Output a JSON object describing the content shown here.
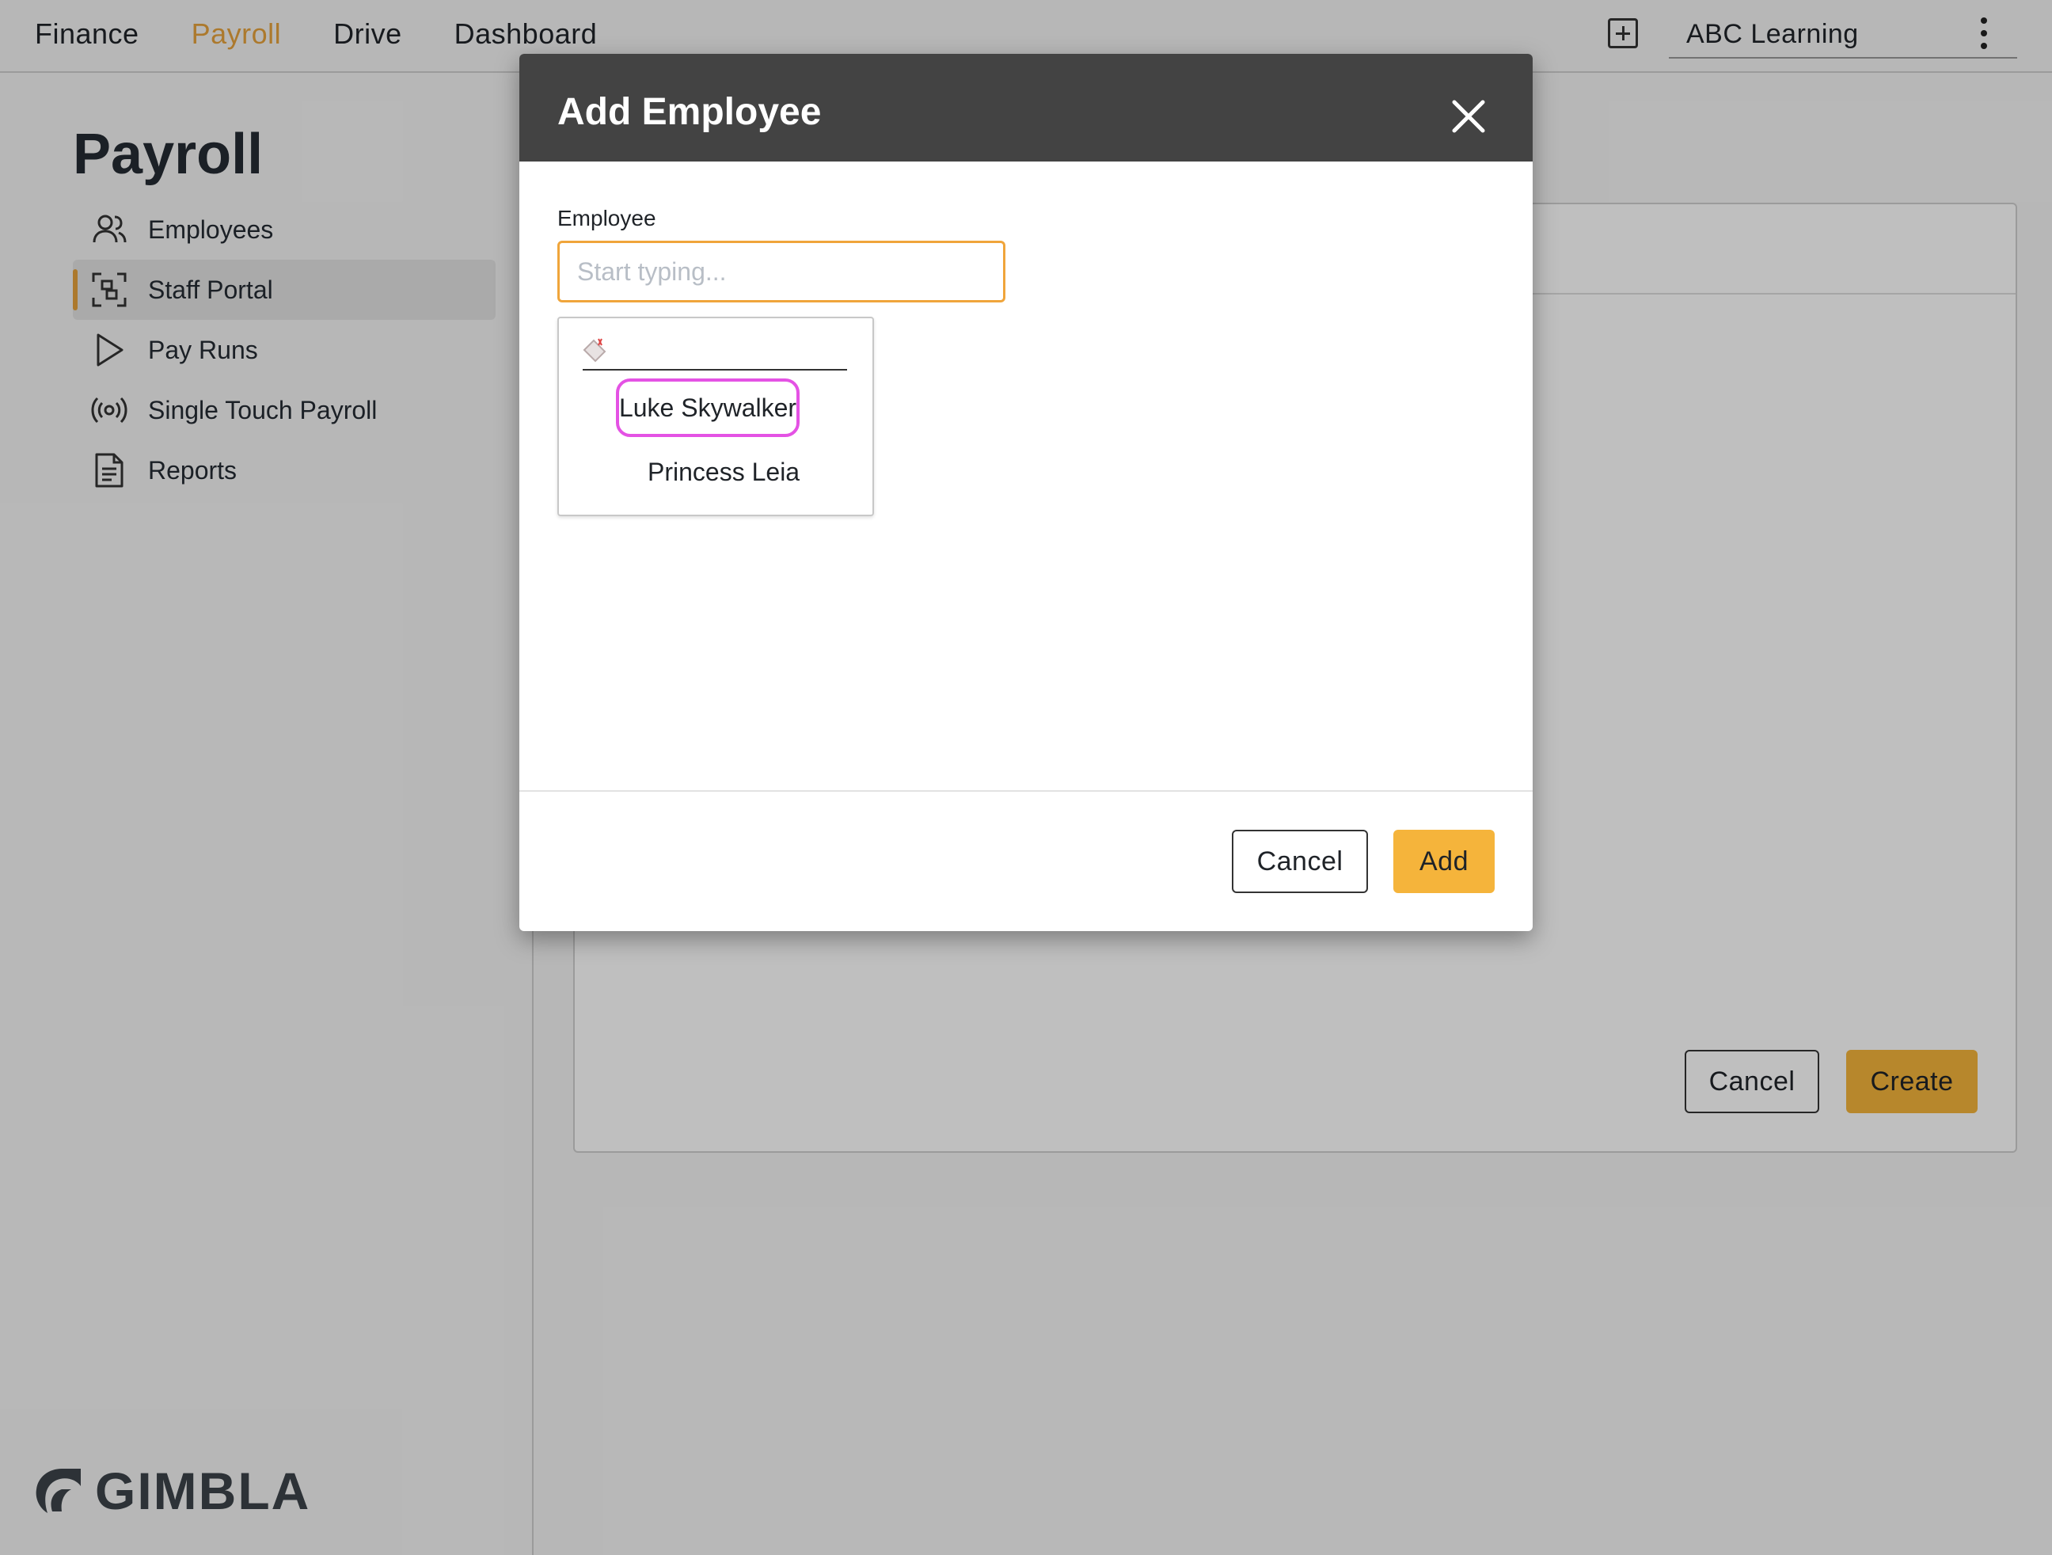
{
  "topnav": {
    "items": [
      {
        "label": "Finance",
        "active": false
      },
      {
        "label": "Payroll",
        "active": true
      },
      {
        "label": "Drive",
        "active": false
      },
      {
        "label": "Dashboard",
        "active": false
      }
    ],
    "add_icon": "plus-square-icon",
    "organization": "ABC Learning",
    "menu_icon": "kebab-menu-icon"
  },
  "sidebar": {
    "title": "Payroll",
    "items": [
      {
        "label": "Employees",
        "icon": "people-icon",
        "active": false
      },
      {
        "label": "Staff Portal",
        "icon": "scan-portal-icon",
        "active": true
      },
      {
        "label": "Pay Runs",
        "icon": "play-icon",
        "active": false
      },
      {
        "label": "Single Touch Payroll",
        "icon": "broadcast-icon",
        "active": false
      },
      {
        "label": "Reports",
        "icon": "document-icon",
        "active": false
      }
    ],
    "logo_text": "GIMBLA"
  },
  "background_form": {
    "cancel_label": "Cancel",
    "create_label": "Create"
  },
  "modal": {
    "title": "Add Employee",
    "field_label": "Employee",
    "input_placeholder": "Start typing...",
    "input_value": "",
    "options": [
      "Luke Skywalker",
      "Princess Leia"
    ],
    "cancel_label": "Cancel",
    "add_label": "Add"
  },
  "colors": {
    "accent": "#e6a23c",
    "primary_button": "#f5b43b",
    "modal_header": "#434343",
    "focus_border": "#f0a53b",
    "highlight_ring": "#e452e4"
  }
}
